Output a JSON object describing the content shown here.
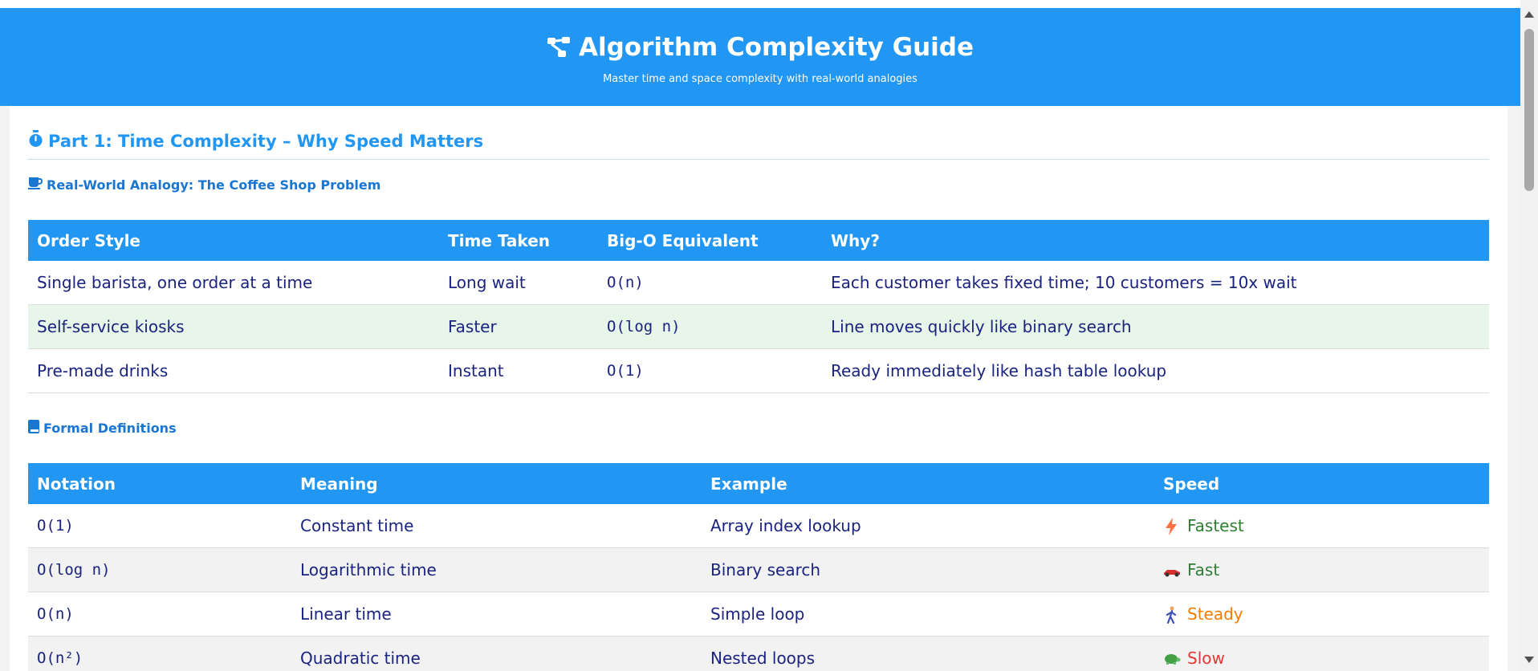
{
  "header": {
    "icon": "sitemap-icon",
    "title": "Algorithm Complexity Guide",
    "subtitle": "Master time and space complexity with real-world analogies"
  },
  "section1": {
    "icon": "stopwatch-icon",
    "title": "Part 1: Time Complexity – Why Speed Matters",
    "analogy": {
      "icon": "coffee-icon",
      "title": "Real-World Analogy: The Coffee Shop Problem",
      "headers": [
        "Order Style",
        "Time Taken",
        "Big-O Equivalent",
        "Why?"
      ],
      "rows": [
        {
          "style": "Single barista, one order at a time",
          "time": "Long wait",
          "bigo": "O(n)",
          "why": "Each customer takes fixed time; 10 customers = 10x wait"
        },
        {
          "style": "Self-service kiosks",
          "time": "Faster",
          "bigo": "O(log n)",
          "why": "Line moves quickly like binary search"
        },
        {
          "style": "Pre-made drinks",
          "time": "Instant",
          "bigo": "O(1)",
          "why": "Ready immediately like hash table lookup"
        }
      ]
    },
    "definitions": {
      "icon": "book-icon",
      "title": "Formal Definitions",
      "headers": [
        "Notation",
        "Meaning",
        "Example",
        "Speed"
      ],
      "rows": [
        {
          "notation": "O(1)",
          "meaning": "Constant time",
          "example": "Array index lookup",
          "speed": "Fastest",
          "speed_icon": "lightning-icon",
          "speed_color": "#2e7d32"
        },
        {
          "notation": "O(log n)",
          "meaning": "Logarithmic time",
          "example": "Binary search",
          "speed": "Fast",
          "speed_icon": "race-car-icon",
          "speed_color": "#2e7d32"
        },
        {
          "notation": "O(n)",
          "meaning": "Linear time",
          "example": "Simple loop",
          "speed": "Steady",
          "speed_icon": "walking-person-icon",
          "speed_color": "#f57c00"
        },
        {
          "notation": "O(n²)",
          "meaning": "Quadratic time",
          "example": "Nested loops",
          "speed": "Slow",
          "speed_icon": "turtle-icon",
          "speed_color": "#e53935"
        }
      ]
    }
  },
  "colors": {
    "primary": "#2196f3",
    "text": "#1a237e",
    "highlight_row": "#e8f5e9"
  }
}
